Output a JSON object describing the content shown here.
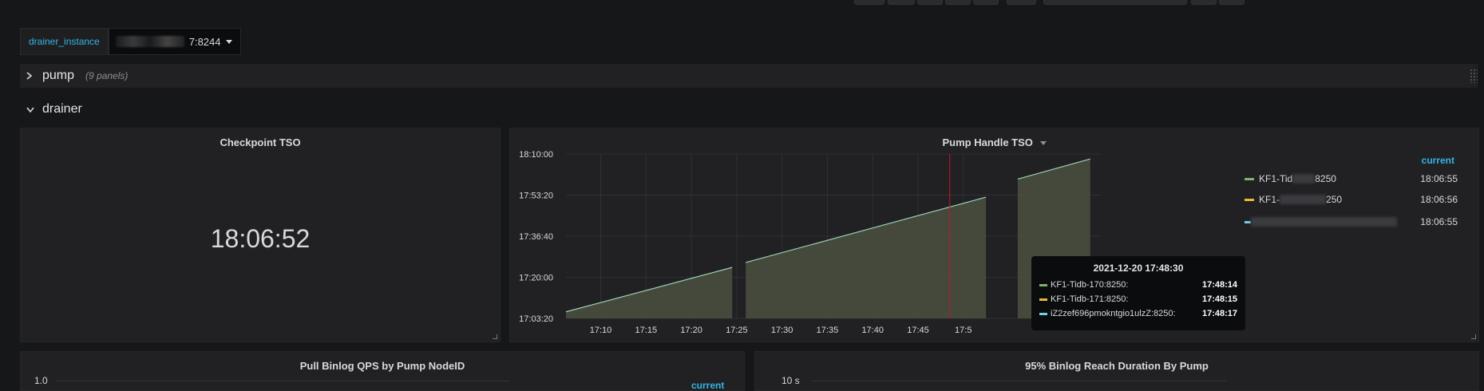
{
  "variables": {
    "label": "drainer_instance",
    "value_suffix": "7:8244"
  },
  "rows": {
    "pump": {
      "title": "pump",
      "subtitle": "(9 panels)"
    },
    "drainer": {
      "title": "drainer"
    }
  },
  "panels": {
    "checkpoint": {
      "title": "Checkpoint TSO",
      "value": "18:06:52"
    },
    "pump_handle": {
      "title": "Pump Handle TSO",
      "legend_header": "current",
      "legend": [
        {
          "name": "KF1-Tid",
          "suffix": "8250",
          "value": "18:06:55",
          "color": "#7eb26d"
        },
        {
          "name": "KF1-",
          "suffix": "250",
          "value": "18:06:56",
          "color": "#eab839"
        },
        {
          "name": "",
          "suffix": "",
          "value": "18:06:55",
          "color": "#6ed0e0"
        }
      ],
      "tooltip": {
        "time": "2021-12-20 17:48:30",
        "rows": [
          {
            "name": "KF1-Tidb-170:8250:",
            "value": "17:48:14",
            "color": "#7eb26d"
          },
          {
            "name": "KF1-Tidb-171:8250:",
            "value": "17:48:15",
            "color": "#eab839"
          },
          {
            "name": "iZ2zef696pmokntgio1ulzZ:8250:",
            "value": "17:48:17",
            "color": "#6ed0e0"
          }
        ]
      }
    },
    "pull_binlog": {
      "title": "Pull Binlog QPS by Pump NodeID",
      "y_top": "1.0",
      "legend_header": "current"
    },
    "reach_duration": {
      "title": "95% Binlog Reach Duration By Pump",
      "y_top": "10 s"
    }
  },
  "chart_data": {
    "type": "area",
    "title": "Pump Handle TSO",
    "x_ticks": [
      "17:10",
      "17:15",
      "17:20",
      "17:25",
      "17:30",
      "17:35",
      "17:40",
      "17:45",
      "17:5"
    ],
    "y_ticks": [
      "18:10:00",
      "17:53:20",
      "17:36:40",
      "17:20:00",
      "17:03:20"
    ],
    "ylim": [
      "17:03:20",
      "18:10:00"
    ],
    "segments": [
      {
        "x": [
          "17:06:10",
          "17:24:30"
        ],
        "y": [
          "17:06:00",
          "17:24:00"
        ]
      },
      {
        "x": [
          "17:26:00",
          "17:44:00",
          "17:45:20",
          "17:52:30"
        ],
        "y": [
          "17:26:00",
          "17:44:00",
          "17:45:20",
          "17:52:30"
        ]
      },
      {
        "x": [
          "17:56:00",
          "18:04:00"
        ],
        "y": [
          "17:59:50",
          "18:08:00"
        ]
      }
    ],
    "fill_color": "#4b5040",
    "line_color": "#9ad1b5",
    "crosshair_x": "17:48:30"
  }
}
